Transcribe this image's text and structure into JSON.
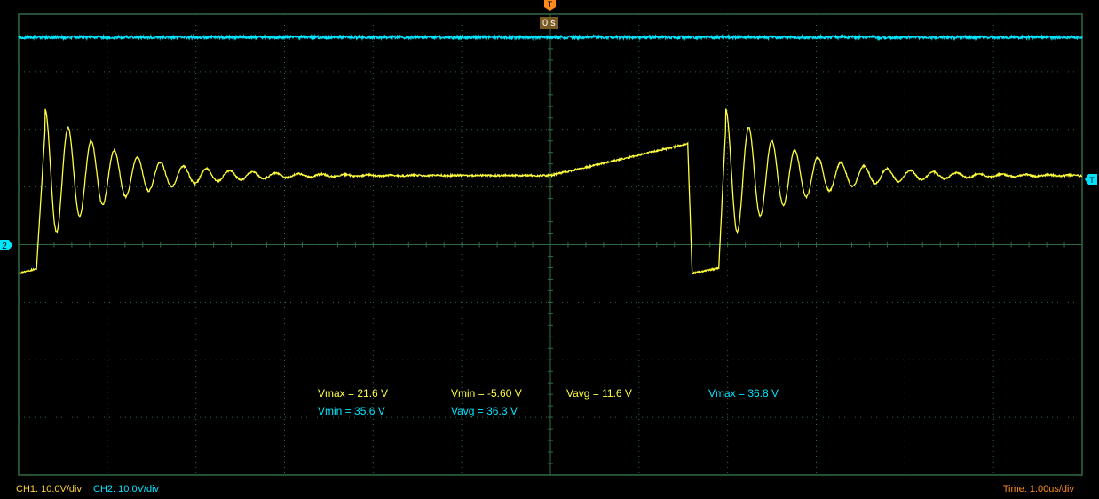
{
  "chart_data": {
    "type": "line",
    "xlabel": "",
    "ylabel": "",
    "grid": true,
    "divisions": {
      "x": 12,
      "y": 8
    },
    "time_per_div_us": 1.0,
    "volts_per_div": {
      "CH1": 10.0,
      "CH2": 10.0
    },
    "series": [
      {
        "name": "CH1",
        "color": "#ffff3c",
        "description_points": "piecewise: flat low, fast rise with damped ringing, plateau, slow ramp, fall",
        "x_div": [
          0.0,
          0.2,
          0.27,
          0.3,
          2.3,
          6.0,
          7.3,
          7.6,
          7.65,
          7.9,
          7.95,
          12.0
        ],
        "y_div": [
          -0.5,
          -0.4,
          1.5,
          2.1,
          1.2,
          1.2,
          1.7,
          1.75,
          -0.5,
          -0.4,
          2.1,
          1.2
        ]
      },
      {
        "name": "CH2",
        "color": "#00e5ff",
        "x_div": [
          0,
          12
        ],
        "y_div": [
          3.6,
          3.6
        ]
      }
    ],
    "ringing": {
      "decay": 0.85,
      "cycles": 18
    }
  },
  "measurements": [
    {
      "label": "Vmax = 21.6 V",
      "color": "y"
    },
    {
      "label": "Vmin = -5.60 V",
      "color": "y"
    },
    {
      "label": "Vavg = 11.6 V",
      "color": "y"
    },
    {
      "label": "Vmax = 36.8 V",
      "color": "c"
    },
    {
      "label": "Vmin = 35.6 V",
      "color": "c"
    },
    {
      "label": "Vavg = 36.3 V",
      "color": "c"
    }
  ],
  "status": {
    "ch1": "CH1: 10.0V/div",
    "ch2": "CH2: 10.0V/div",
    "time": "Time: 1.00us/div"
  },
  "trigger": {
    "time_label": "0 s",
    "marker_label": "T"
  },
  "channel_marker": {
    "label": "2"
  },
  "colors": {
    "grid": "#2f6b42",
    "ch1": "#ffff3c",
    "ch2": "#00e5ff",
    "trigger": "#ff8c1a",
    "status_time": "#ff8c1a"
  }
}
